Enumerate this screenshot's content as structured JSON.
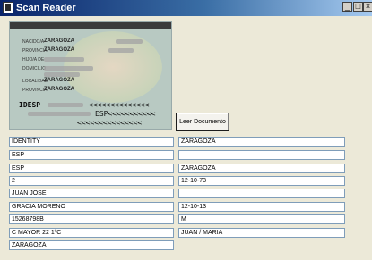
{
  "window": {
    "title": "Scan Reader",
    "minimize": "_",
    "maximize": "□",
    "close": "×"
  },
  "card": {
    "labels": [
      "NACIDO/A",
      "PROVINCIA",
      "HIJO/A DE",
      "DOMICILIO",
      "LOCALIDAD",
      "PROVINCIA"
    ],
    "values": [
      "ZARAGOZA",
      "ZARAGOZA",
      "ZARAGOZA",
      "ZARAGOZA"
    ],
    "mrz": [
      "IDESP",
      "<<<<<<<<<<<<<<",
      "ESP<<<<<<<<<<<",
      "<<<<<<<<<<<<<<<"
    ]
  },
  "read_button": {
    "label": "Leer Documento"
  },
  "fields_left": [
    "IDENTITY",
    "ESP",
    "ESP",
    "2",
    "JUAN JOSE",
    "GRACIA MORENO",
    "15268798B",
    "C MAYOR 22 1ºC",
    "ZARAGOZA"
  ],
  "fields_right": [
    "ZARAGOZA",
    "",
    "ZARAGOZA",
    "12-10-73",
    "",
    "12-10-13",
    "M",
    "JUAN / MARIA"
  ]
}
